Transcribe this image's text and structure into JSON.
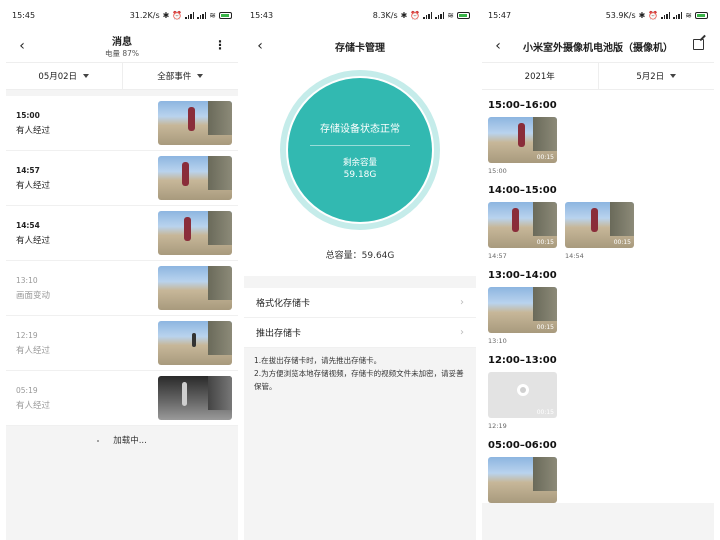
{
  "phone1": {
    "status": {
      "time": "15:45",
      "speed": "31.2K/s"
    },
    "header": {
      "title": "消息",
      "subtitle": "电量 87%"
    },
    "filters": {
      "date": "05月02日",
      "events": "全部事件"
    },
    "rows": [
      {
        "time": "15:00",
        "desc": "有人经过",
        "dim": false
      },
      {
        "time": "14:57",
        "desc": "有人经过",
        "dim": false
      },
      {
        "time": "14:54",
        "desc": "有人经过",
        "dim": false
      },
      {
        "time": "13:10",
        "desc": "画面变动",
        "dim": true
      },
      {
        "time": "12:19",
        "desc": "有人经过",
        "dim": true
      },
      {
        "time": "05:19",
        "desc": "有人经过",
        "dim": true
      }
    ],
    "loading": "加载中..."
  },
  "phone2": {
    "status": {
      "time": "15:43",
      "speed": "8.3K/s"
    },
    "header": {
      "title": "存储卡管理"
    },
    "circle": {
      "status": "存储设备状态正常",
      "remaining_label": "剩余容量",
      "remaining_value": "59.18G"
    },
    "total": "总容量：59.64G",
    "menu": {
      "format": "格式化存储卡",
      "eject": "推出存储卡"
    },
    "notes": [
      "1.在拔出存储卡时，请先推出存储卡。",
      "2.为方便浏览本地存储视频，存储卡的视频文件未加密，请妥善保管。"
    ]
  },
  "phone3": {
    "status": {
      "time": "15:47",
      "speed": "53.9K/s"
    },
    "header": {
      "title": "小米室外摄像机电池版（摄像机）"
    },
    "filters": {
      "year": "2021年",
      "date": "5月2日"
    },
    "stamp": "00:15",
    "sections": [
      {
        "label": "15:00–16:00",
        "clips": [
          "15:00"
        ]
      },
      {
        "label": "14:00–15:00",
        "clips": [
          "14:57",
          "14:54"
        ]
      },
      {
        "label": "13:00–14:00",
        "clips": [
          "13:10"
        ]
      },
      {
        "label": "12:00–13:00",
        "clips": [
          "12:19"
        ]
      },
      {
        "label": "05:00–06:00",
        "clips": []
      }
    ]
  }
}
